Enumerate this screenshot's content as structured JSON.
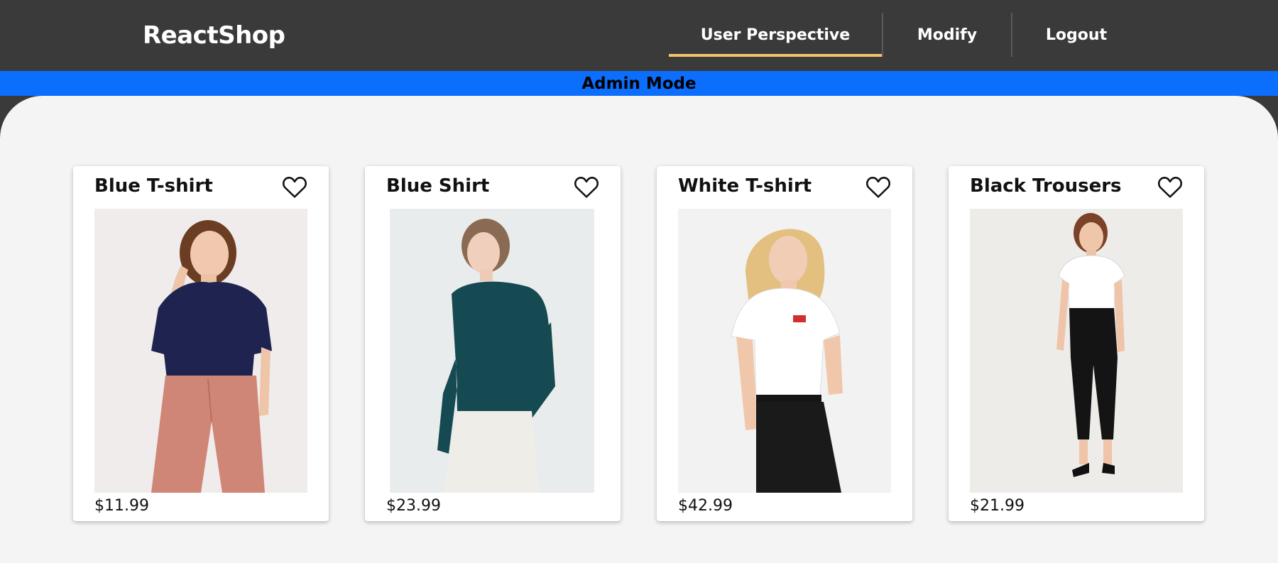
{
  "header": {
    "brand": "ReactShop",
    "nav": [
      {
        "label": "User Perspective",
        "active": true
      },
      {
        "label": "Modify",
        "active": false
      },
      {
        "label": "Logout",
        "active": false
      }
    ]
  },
  "banner": {
    "label": "Admin Mode"
  },
  "products": [
    {
      "title": "Blue T-shirt",
      "price": "$11.99",
      "image": "woman-navy-top-pink-trousers",
      "favorite": false
    },
    {
      "title": "Blue Shirt",
      "price": "$23.99",
      "image": "woman-teal-sweater-white-trousers",
      "favorite": false
    },
    {
      "title": "White T-shirt",
      "price": "$42.99",
      "image": "woman-white-tshirt-black-jeans",
      "favorite": false
    },
    {
      "title": "Black Trousers",
      "price": "$21.99",
      "image": "woman-white-top-black-trousers",
      "favorite": false
    }
  ],
  "colors": {
    "header_bg": "#3a3a3a",
    "banner_bg": "#0b6efd",
    "active_underline": "#f4c46b",
    "main_bg": "#f4f4f4"
  }
}
